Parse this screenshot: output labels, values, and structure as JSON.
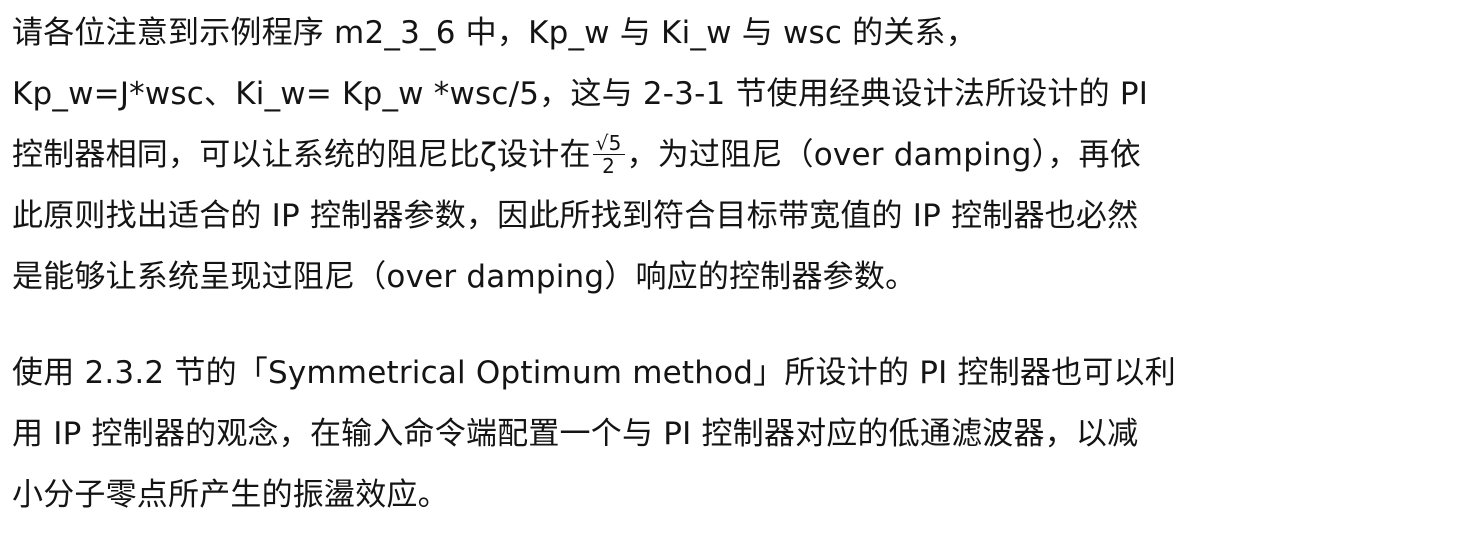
{
  "paragraph1": {
    "line1": "请各位注意到示例程序 m2_3_6 中，Kp_w 与 Ki_w 与 wsc 的关系，",
    "line2": "Kp_w=J*wsc、Ki_w= Kp_w *wsc/5，这与 2-3-1 节使用经典设计法所设计的 PI",
    "line3_before": "控制器相同，可以让系统的阻尼比ζ设计在",
    "fraction_numerator": "√5",
    "fraction_denominator": "2",
    "line3_after": "，为过阻尼（over damping），再依",
    "line4": "此原则找出适合的 IP 控制器参数，因此所找到符合目标带宽值的 IP 控制器也必然",
    "line5": "是能够让系统呈现过阻尼（over damping）响应的控制器参数。"
  },
  "paragraph2": {
    "line1": "使用 2.3.2 节的「Symmetrical Optimum method」所设计的 PI 控制器也可以利",
    "line2": "用 IP 控制器的观念，在输入命令端配置一个与 PI 控制器对应的低通滤波器，以减",
    "line3": "小分子零点所产生的振盪效应。"
  }
}
